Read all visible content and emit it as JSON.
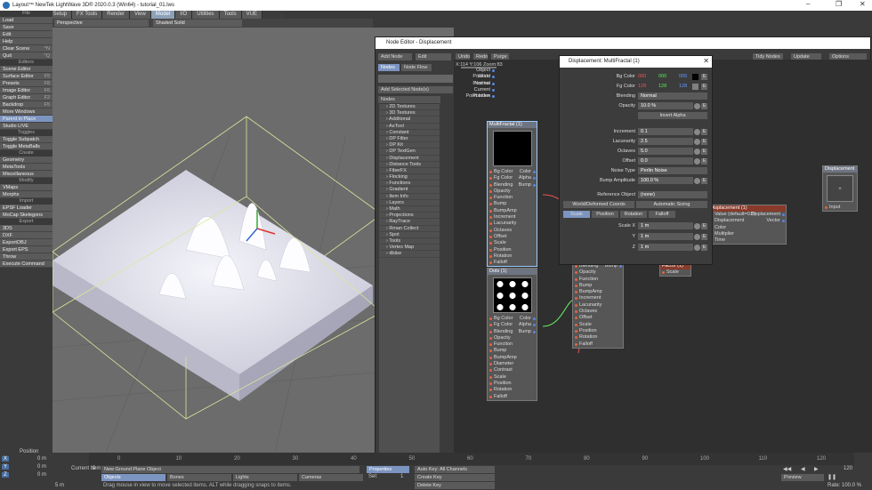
{
  "window": {
    "title": "Layout™ NewTek LightWave 3D® 2020.0.3 (Win64) - tutorial_01.lws"
  },
  "menu_tabs": [
    "Items",
    "Modify",
    "Setup",
    "FX Tools",
    "Render",
    "View",
    "Model",
    "I/O",
    "Utilities",
    "Tools",
    "VUE"
  ],
  "active_tab": "Model",
  "sidebar": {
    "file_header": "File",
    "file": [
      {
        "l": "Load",
        "k": ""
      },
      {
        "l": "Save",
        "k": ""
      },
      {
        "l": "Edit",
        "k": ""
      },
      {
        "l": "Help",
        "k": ""
      },
      {
        "l": "Clear Scene",
        "k": "^N"
      },
      {
        "l": "Quit",
        "k": "^Q"
      }
    ],
    "editors_header": "Editors",
    "editors": [
      {
        "l": "Scene Editor",
        "k": ""
      },
      {
        "l": "Surface Editor",
        "k": "F5"
      },
      {
        "l": "Presets",
        "k": "F8"
      },
      {
        "l": "Image Editor",
        "k": "F6"
      },
      {
        "l": "Graph Editor",
        "k": "F2"
      },
      {
        "l": "Backdrop",
        "k": "F5"
      },
      {
        "l": "More Windows",
        "k": ""
      },
      {
        "l": "Parent in Place",
        "k": ""
      },
      {
        "l": "Studio LIVE",
        "k": ""
      }
    ],
    "toggles_header": "Toggles",
    "toggles": [
      {
        "l": "Toggle Subpatch",
        "k": ""
      },
      {
        "l": "Toggle MetaBalls",
        "k": ""
      }
    ],
    "create_header": "Create",
    "create": [
      {
        "l": "Geometry",
        "k": ""
      },
      {
        "l": "MetaTools",
        "k": ""
      },
      {
        "l": "Miscellaneous",
        "k": ""
      }
    ],
    "modify_header": "Modify",
    "modify": [
      {
        "l": "VMaps",
        "k": ""
      },
      {
        "l": "Morphs",
        "k": ""
      }
    ],
    "import_header": "Import",
    "import": [
      {
        "l": "EPSF Loader",
        "k": ""
      },
      {
        "l": "MoCap Skelegons",
        "k": ""
      }
    ],
    "export_header": "Export",
    "export": [
      {
        "l": "3DS",
        "k": ""
      },
      {
        "l": "DXF",
        "k": ""
      },
      {
        "l": "ExportOBJ",
        "k": ""
      },
      {
        "l": "Export EPS",
        "k": ""
      },
      {
        "l": "Throw",
        "k": ""
      },
      {
        "l": "Execute Command",
        "k": ""
      }
    ]
  },
  "viewport": {
    "view_mode": "Perspective",
    "shading": "Shaded Solid"
  },
  "node_editor": {
    "title": "Node Editor - Displacement",
    "buttons": {
      "add_node": "Add Node",
      "edit": "Edit",
      "undo": "Undo",
      "redo": "Redo",
      "purge": "Purge",
      "tidy": "Tidy Nodes",
      "update": "Update",
      "options": "Options"
    },
    "tabs": {
      "nodes": "Nodes",
      "node_flow": "Node Flow"
    },
    "add_selected": "Add Selected Node(s)",
    "list_header": "Nodes",
    "categories": [
      "2D Textures",
      "3D Textures",
      "Additional",
      "AeTool",
      "Constant",
      "DP Filter",
      "DP Kit",
      "DP TextGen",
      "Displacement",
      "Distance Tools",
      "FiberFX",
      "Flocking",
      "Functions",
      "Gradient",
      "Item Info",
      "Layers",
      "Math",
      "Projections",
      "RayTrace",
      "Rman Collect",
      "Spot",
      "Tools",
      "Vertex Map",
      "db&w"
    ],
    "zoom_text": "X:114 Y:106 Zoom:83",
    "input_node": {
      "ports": [
        "Object Position",
        "World Position",
        "Normal",
        "Current Position",
        "Point Index"
      ]
    },
    "multifractal_node": {
      "title": "MultiFractal (1)",
      "inputs": [
        "Bg Color",
        "Fg Color",
        "Blending",
        "Opacity",
        "Function",
        "Bump",
        "BumpAmp",
        "Increment",
        "Lacunarity",
        "Octaves",
        "Offset",
        "Scale",
        "Position",
        "Rotation",
        "Falloff"
      ],
      "outputs": [
        "Color",
        "Alpha",
        "Bump"
      ]
    },
    "dots_node": {
      "title": "Dots (1)",
      "inputs": [
        "Bg Color",
        "Fg Color",
        "Blending",
        "Opacity",
        "Function",
        "Bump",
        "BumpAmp",
        "Diameter",
        "Contrast",
        "Scale",
        "Position",
        "Rotation",
        "Falloff"
      ],
      "outputs": [
        "Color",
        "Alpha",
        "Bump"
      ]
    },
    "hidden_node": {
      "inputs": [
        "Blending",
        "Opacity",
        "Function",
        "Bump",
        "BumpAmp",
        "Increment",
        "Lacunarity",
        "Octaves",
        "Offset",
        "Scale",
        "Position",
        "Rotation",
        "Falloff"
      ],
      "output": "Bump"
    },
    "displacement_in_node": {
      "title": "Displacement (1)",
      "inputs": [
        "Value (default=0.5)",
        "Displacement",
        "Color",
        "Multiplier",
        "Time"
      ],
      "outputs": [
        "Displacement",
        "Vector"
      ]
    },
    "factor_node": {
      "title": "Factor (1)",
      "port": "Scale"
    },
    "output_node": {
      "title": "Displacement",
      "port": "Input"
    }
  },
  "panel": {
    "title": "Displacement: MultiFractal (1)",
    "bg_color": {
      "label": "Bg Color",
      "r": "000",
      "g": "000",
      "b": "000"
    },
    "fg_color": {
      "label": "Fg Color",
      "r": "128",
      "g": "128",
      "b": "128"
    },
    "blending": {
      "label": "Blending",
      "value": "Normal"
    },
    "opacity": {
      "label": "Opacity",
      "value": "10.0 %"
    },
    "invert_alpha": "Invert Alpha",
    "increment": {
      "label": "Increment",
      "value": "0.1"
    },
    "lacunarity": {
      "label": "Lacunarity",
      "value": "2.5"
    },
    "octaves": {
      "label": "Octaves",
      "value": "5.0"
    },
    "offset": {
      "label": "Offset",
      "value": "0.0"
    },
    "noise_type": {
      "label": "Noise Type",
      "value": "Perlin Noise"
    },
    "bump_amp": {
      "label": "Bump Amplitude",
      "value": "100.0 %"
    },
    "ref_object": {
      "label": "Reference Object",
      "value": "(none)"
    },
    "world_coords": "World/Deformed Coords",
    "auto_sizing": "Automatic Sizing",
    "tabs": [
      "Scale",
      "Position",
      "Rotation",
      "Falloff"
    ],
    "scale_x": {
      "label": "Scale X",
      "value": "1 m"
    },
    "scale_y": {
      "label": "Y",
      "value": "1 m"
    },
    "scale_z": {
      "label": "Z",
      "value": "1 m"
    }
  },
  "timeline": {
    "position_label": "Position",
    "ticks": [
      "0",
      "10",
      "20",
      "30",
      "40",
      "50",
      "60",
      "70",
      "80",
      "90",
      "100",
      "110",
      "120"
    ],
    "coords": [
      {
        "axis": "X",
        "value": "0 m"
      },
      {
        "axis": "Y",
        "value": "0 m"
      },
      {
        "axis": "Z",
        "value": "0 m"
      }
    ],
    "grid_value": "5 m",
    "current_item_label": "Current Item",
    "current_item": "New Ground Plane Object",
    "objects": "Objects",
    "bones": "Bones",
    "lights": "Lights",
    "cameras": "Cameras",
    "properties": "Properties",
    "sel_label": "Sel:",
    "sel_value": "1",
    "auto_key": "Auto Key: All Channels",
    "create_key": "Create Key",
    "delete_key": "Delete Key",
    "preview": "Preview",
    "rate_label": "Rate:",
    "rate_value": "100.0 %",
    "start_frame": "0",
    "end_frame": "120",
    "hint": "Drag mouse in view to move selected items. ALT while dragging snaps to items."
  }
}
